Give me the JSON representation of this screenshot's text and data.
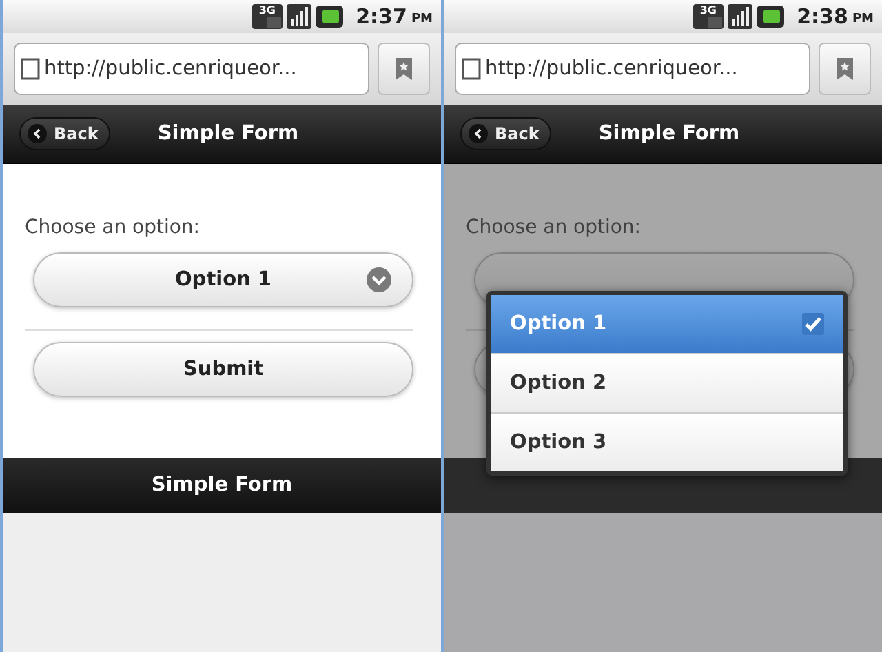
{
  "screens": [
    {
      "status_bar": {
        "network": "3G",
        "time": "2:37",
        "meridiem": "PM"
      },
      "address_bar": {
        "url": "http://public.cenriqueor..."
      },
      "header": {
        "back": "Back",
        "title": "Simple Form"
      },
      "form": {
        "label": "Choose an option:",
        "select": {
          "value": "Option 1"
        },
        "submit": "Submit"
      },
      "footer": {
        "title": "Simple Form"
      }
    },
    {
      "status_bar": {
        "network": "3G",
        "time": "2:38",
        "meridiem": "PM"
      },
      "address_bar": {
        "url": "http://public.cenriqueor..."
      },
      "header": {
        "back": "Back",
        "title": "Simple Form"
      },
      "form": {
        "label": "Choose an option:"
      },
      "menu": {
        "options": [
          {
            "label": "Option 1",
            "selected": true
          },
          {
            "label": "Option 2",
            "selected": false
          },
          {
            "label": "Option 3",
            "selected": false
          }
        ]
      }
    }
  ]
}
